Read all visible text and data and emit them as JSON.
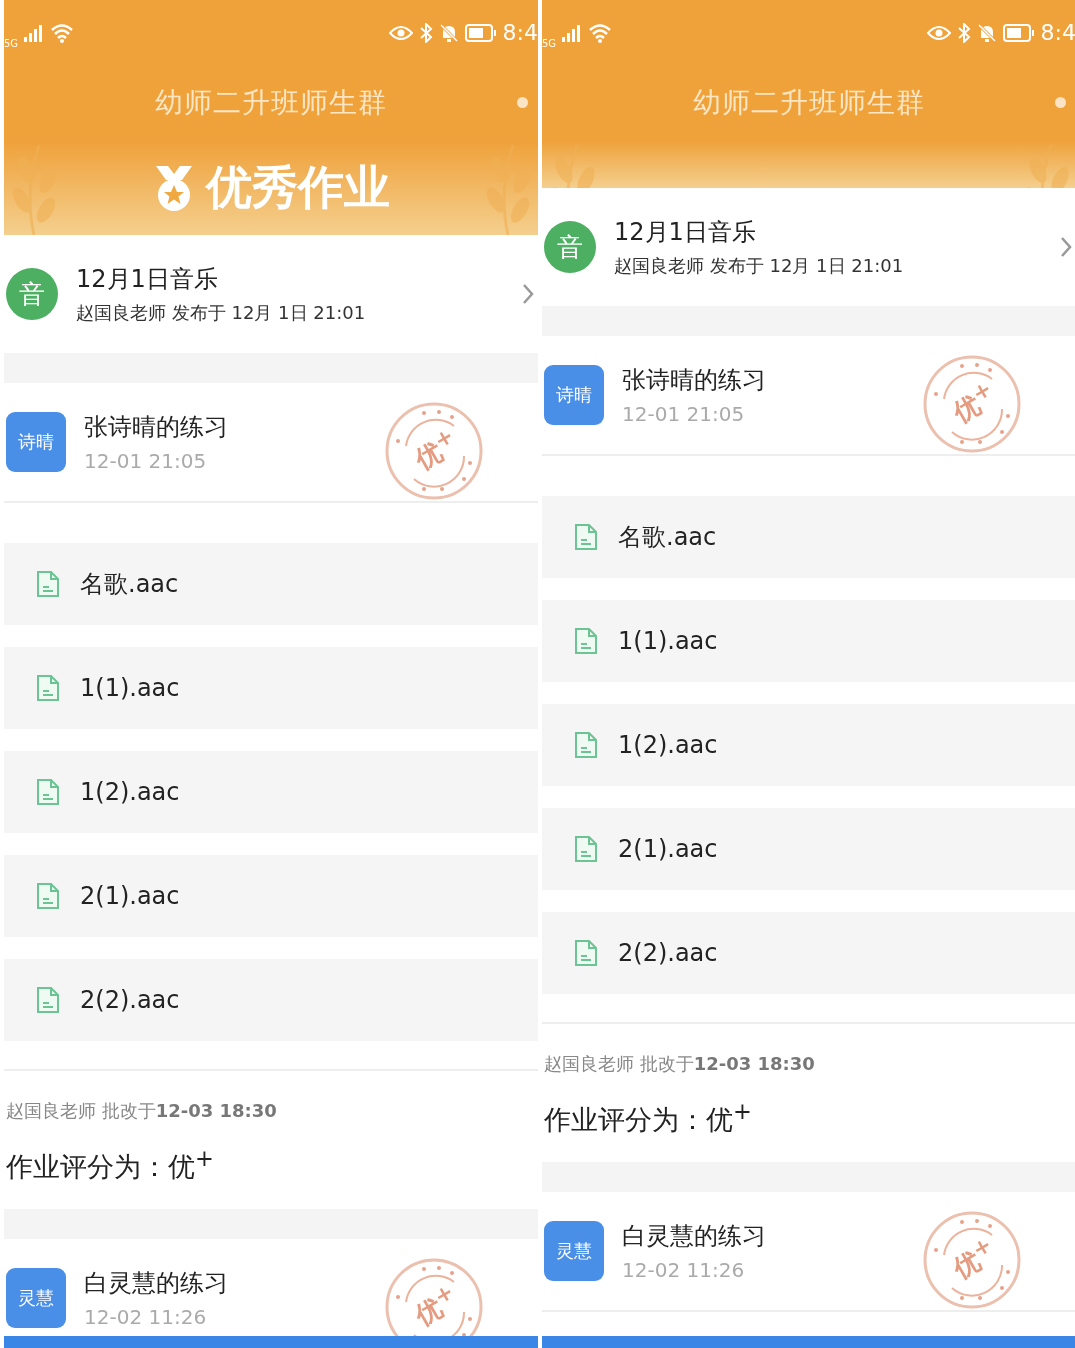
{
  "panels": [
    {
      "status_bar": {
        "network": "5G",
        "time": "8:4"
      },
      "header": {
        "title": "幼师二升班师生群",
        "expanded": true,
        "banner_title": "优秀作业"
      },
      "assignment": {
        "avatar": "音",
        "title": "12月1日音乐",
        "subtitle": "赵国良老师 发布于 12月 1日 21:01"
      },
      "submissions": [
        {
          "avatar": "诗晴",
          "title": "张诗晴的练习",
          "time": "12-01 21:05",
          "stamp": "优$^{+}$",
          "files": [
            "名歌.aac",
            "1(1).aac",
            "1(2).aac",
            "2(1).aac",
            "2(2).aac"
          ],
          "review": {
            "line": "赵国良老师 批改于**12-03 18:30**",
            "grade": "作业评分为：优$^{+}$"
          }
        },
        {
          "avatar": "灵慧",
          "title": "白灵慧的练习",
          "time": "12-02 11:26",
          "stamp": "优$^{+}$"
        }
      ]
    },
    {
      "status_bar": {
        "network": "5G",
        "time": "8:4"
      },
      "header": {
        "title": "幼师二升班师生群",
        "expanded": false
      },
      "assignment": {
        "avatar": "音",
        "title": "12月1日音乐",
        "subtitle": "赵国良老师 发布于 12月 1日 21:01"
      },
      "submissions": [
        {
          "avatar": "诗晴",
          "title": "张诗晴的练习",
          "time": "12-01 21:05",
          "stamp": "优$^{+}$",
          "files": [
            "名歌.aac",
            "1(1).aac",
            "1(2).aac",
            "2(1).aac",
            "2(2).aac"
          ],
          "review": {
            "line": "赵国良老师 批改于**12-03 18:30**",
            "grade": "作业评分为：优$^{+}$"
          }
        },
        {
          "avatar": "灵慧",
          "title": "白灵慧的练习",
          "time": "12-02 11:26",
          "stamp": "优$^{+}$"
        }
      ]
    }
  ]
}
